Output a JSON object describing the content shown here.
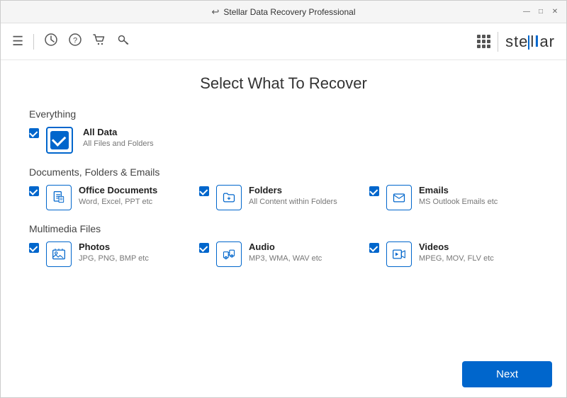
{
  "titlebar": {
    "title": "Stellar Data Recovery Professional",
    "back_icon": "↩",
    "min_label": "—",
    "max_label": "□",
    "close_label": "✕"
  },
  "toolbar": {
    "hamburger_icon": "☰",
    "history_icon": "🕐",
    "help_icon": "?",
    "cart_icon": "🛒",
    "key_icon": "🔑",
    "brand": "stellar"
  },
  "page": {
    "title": "Select What To Recover"
  },
  "sections": [
    {
      "label": "Everything",
      "items": [
        {
          "name": "All Data",
          "desc": "All Files and Folders",
          "icon": "alldata",
          "checked": true
        }
      ]
    },
    {
      "label": "Documents, Folders & Emails",
      "items": [
        {
          "name": "Office Documents",
          "desc": "Word, Excel, PPT etc",
          "icon": "documents",
          "checked": true
        },
        {
          "name": "Folders",
          "desc": "All Content within Folders",
          "icon": "folders",
          "checked": true
        },
        {
          "name": "Emails",
          "desc": "MS Outlook Emails etc",
          "icon": "emails",
          "checked": true
        }
      ]
    },
    {
      "label": "Multimedia Files",
      "items": [
        {
          "name": "Photos",
          "desc": "JPG, PNG, BMP etc",
          "icon": "photos",
          "checked": true
        },
        {
          "name": "Audio",
          "desc": "MP3, WMA, WAV etc",
          "icon": "audio",
          "checked": true
        },
        {
          "name": "Videos",
          "desc": "MPEG, MOV, FLV etc",
          "icon": "videos",
          "checked": true
        }
      ]
    }
  ],
  "footer": {
    "next_label": "Next"
  }
}
